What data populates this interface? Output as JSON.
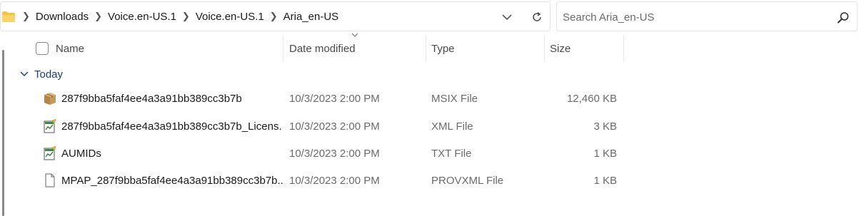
{
  "address_bar": {
    "folder_icon": "folder-icon",
    "breadcrumbs": [
      "Downloads",
      "Voice.en-US.1",
      "Voice.en-US.1",
      "Aria_en-US"
    ],
    "dropdown_icon": "chevron-down-icon",
    "refresh_icon": "refresh-icon"
  },
  "search": {
    "placeholder": "Search Aria_en-US",
    "value": "",
    "icon": "search-icon"
  },
  "columns": {
    "name": "Name",
    "date_modified": "Date modified",
    "type": "Type",
    "size": "Size",
    "sorted_by": "Date modified"
  },
  "group": {
    "label": "Today",
    "expanded": true
  },
  "files": [
    {
      "name": "287f9bba5faf4ee4a3a91bb389cc3b7b",
      "date": "10/3/2023 2:00 PM",
      "type": "MSIX File",
      "size": "12,460 KB",
      "icon": "package-icon"
    },
    {
      "name": "287f9bba5faf4ee4a3a91bb389cc3b7b_Licens...",
      "date": "10/3/2023 2:00 PM",
      "type": "XML File",
      "size": "3 KB",
      "icon": "xml-file-icon"
    },
    {
      "name": "AUMIDs",
      "date": "10/3/2023 2:00 PM",
      "type": "TXT File",
      "size": "1 KB",
      "icon": "text-file-icon"
    },
    {
      "name": "MPAP_287f9bba5faf4ee4a3a91bb389cc3b7b...",
      "date": "10/3/2023 2:00 PM",
      "type": "PROVXML File",
      "size": "1 KB",
      "icon": "blank-file-icon"
    }
  ],
  "colors": {
    "group_label": "#1f3c7a",
    "folder_yellow": "#f4c542",
    "secondary_text": "#6b6b6b"
  }
}
